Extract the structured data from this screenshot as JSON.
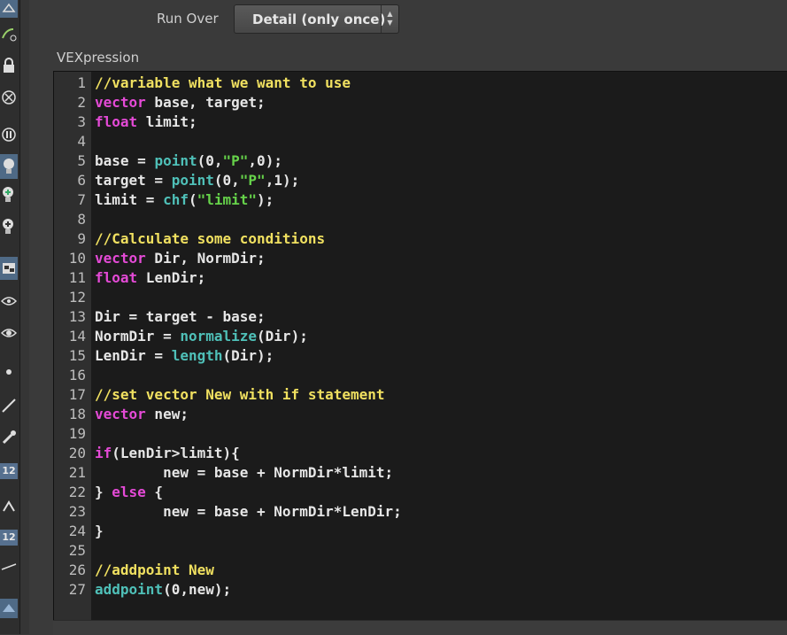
{
  "toolbar": {
    "tools": [
      {
        "icon": "geometry-node-icon",
        "selected": true
      },
      {
        "icon": "bend-icon",
        "selected": false
      },
      {
        "icon": "lock-icon",
        "selected": false
      },
      {
        "icon": "bypass-icon",
        "selected": false
      },
      {
        "icon": "template-icon",
        "selected": false
      },
      {
        "icon": "light-bulb-icon",
        "selected": true
      },
      {
        "icon": "add-light-icon",
        "selected": false
      },
      {
        "icon": "add-light-alt-icon",
        "selected": false
      },
      {
        "icon": "render-icon",
        "selected": true
      },
      {
        "icon": "eye-icon",
        "selected": false
      },
      {
        "icon": "eye-alt-icon",
        "selected": false
      },
      {
        "icon": "point-icon",
        "selected": false
      },
      {
        "icon": "line-tool-icon",
        "selected": false
      },
      {
        "icon": "brush-icon",
        "selected": false
      },
      {
        "icon": "edge-tool-icon",
        "selected": false
      },
      {
        "icon": "plane-icon",
        "selected": true
      }
    ],
    "badges": [
      "12",
      "12"
    ]
  },
  "params": {
    "run_over_label": "Run Over",
    "run_over_value": "Detail (only once)",
    "vexpression_label": "VEXpression"
  },
  "code": {
    "lines": [
      [
        {
          "t": "comment",
          "s": "//variable what we want to use"
        }
      ],
      [
        {
          "t": "type",
          "s": "vector"
        },
        {
          "t": "plain",
          "s": " base, target;"
        }
      ],
      [
        {
          "t": "type",
          "s": "float"
        },
        {
          "t": "plain",
          "s": " limit;"
        }
      ],
      [],
      [
        {
          "t": "plain",
          "s": "base = "
        },
        {
          "t": "fn",
          "s": "point"
        },
        {
          "t": "plain",
          "s": "(0,"
        },
        {
          "t": "str",
          "s": "\"P\""
        },
        {
          "t": "plain",
          "s": ",0);"
        }
      ],
      [
        {
          "t": "plain",
          "s": "target = "
        },
        {
          "t": "fn",
          "s": "point"
        },
        {
          "t": "plain",
          "s": "(0,"
        },
        {
          "t": "str",
          "s": "\"P\""
        },
        {
          "t": "plain",
          "s": ",1);"
        }
      ],
      [
        {
          "t": "plain",
          "s": "limit = "
        },
        {
          "t": "fn",
          "s": "chf"
        },
        {
          "t": "plain",
          "s": "("
        },
        {
          "t": "str",
          "s": "\"limit\""
        },
        {
          "t": "plain",
          "s": ");"
        }
      ],
      [],
      [
        {
          "t": "comment",
          "s": "//Calculate some conditions"
        }
      ],
      [
        {
          "t": "type",
          "s": "vector"
        },
        {
          "t": "plain",
          "s": " Dir, NormDir;"
        }
      ],
      [
        {
          "t": "type",
          "s": "float"
        },
        {
          "t": "plain",
          "s": " LenDir;"
        }
      ],
      [],
      [
        {
          "t": "plain",
          "s": "Dir = target - base;"
        }
      ],
      [
        {
          "t": "plain",
          "s": "NormDir = "
        },
        {
          "t": "fn",
          "s": "normalize"
        },
        {
          "t": "plain",
          "s": "(Dir);"
        }
      ],
      [
        {
          "t": "plain",
          "s": "LenDir = "
        },
        {
          "t": "fn",
          "s": "length"
        },
        {
          "t": "plain",
          "s": "(Dir);"
        }
      ],
      [],
      [
        {
          "t": "comment",
          "s": "//set vector New with if statement"
        }
      ],
      [
        {
          "t": "type",
          "s": "vector"
        },
        {
          "t": "plain",
          "s": " new;"
        }
      ],
      [],
      [
        {
          "t": "kw",
          "s": "if"
        },
        {
          "t": "plain",
          "s": "(LenDir>limit){"
        }
      ],
      [
        {
          "t": "plain",
          "s": "        new = base + NormDir*limit;"
        }
      ],
      [
        {
          "t": "plain",
          "s": "} "
        },
        {
          "t": "kw",
          "s": "else"
        },
        {
          "t": "plain",
          "s": " {"
        }
      ],
      [
        {
          "t": "plain",
          "s": "        new = base + NormDir*LenDir;"
        }
      ],
      [
        {
          "t": "plain",
          "s": "}"
        }
      ],
      [],
      [
        {
          "t": "comment",
          "s": "//addpoint New"
        }
      ],
      [
        {
          "t": "fn",
          "s": "addpoint"
        },
        {
          "t": "plain",
          "s": "(0,new);"
        }
      ]
    ]
  }
}
